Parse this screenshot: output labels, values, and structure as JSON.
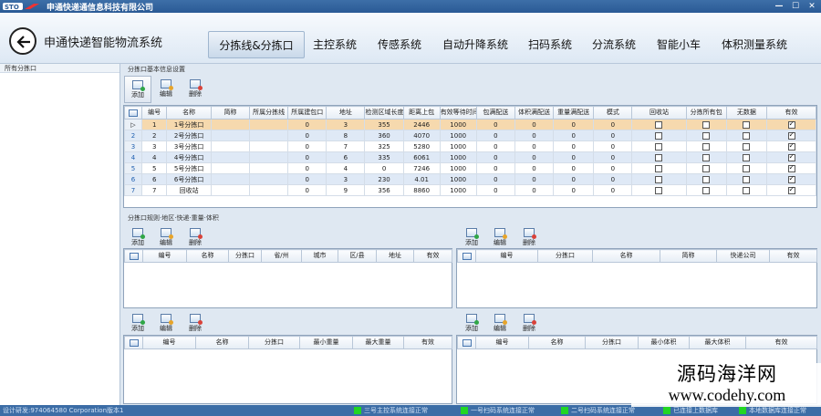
{
  "window": {
    "title": "申通快递通信息科技有限公司",
    "controls": [
      "—",
      "☐",
      "✕"
    ]
  },
  "app": {
    "title": "申通快递智能物流系统"
  },
  "nav": [
    "分拣线&分拣口",
    "主控系统",
    "传感系统",
    "自动升降系统",
    "扫码系统",
    "分流系统",
    "智能小车",
    "体积测量系统"
  ],
  "sidebar": {
    "header": "所有分拣口"
  },
  "top_section": {
    "title": "分拣口基本信息设置",
    "toolbar": [
      "添加",
      "编辑",
      "删除"
    ],
    "columns": [
      "编号",
      "名称",
      "简称",
      "所属分拣线",
      "所属建包口",
      "地址",
      "检测区域长度",
      "距离上包",
      "有效等待时间",
      "包满配送",
      "体积满配送",
      "重量满配送",
      "模式",
      "回收站",
      "分拣所有包",
      "无数据",
      "有效"
    ],
    "rows": [
      {
        "rownum": "1",
        "cells": [
          "1",
          "1号分拣口",
          "",
          "",
          "0",
          "3",
          "355",
          "2446",
          "1000",
          "0",
          "0",
          "0",
          "0"
        ],
        "flags": [
          false,
          false,
          false,
          true
        ]
      },
      {
        "rownum": "2",
        "cells": [
          "2",
          "2号分拣口",
          "",
          "",
          "0",
          "8",
          "360",
          "4070",
          "1000",
          "0",
          "0",
          "0",
          "0"
        ],
        "flags": [
          false,
          false,
          false,
          true
        ]
      },
      {
        "rownum": "3",
        "cells": [
          "3",
          "3号分拣口",
          "",
          "",
          "0",
          "7",
          "325",
          "5280",
          "1000",
          "0",
          "0",
          "0",
          "0"
        ],
        "flags": [
          false,
          false,
          false,
          true
        ]
      },
      {
        "rownum": "4",
        "cells": [
          "4",
          "4号分拣口",
          "",
          "",
          "0",
          "6",
          "335",
          "6061",
          "1000",
          "0",
          "0",
          "0",
          "0"
        ],
        "flags": [
          false,
          false,
          false,
          true
        ]
      },
      {
        "rownum": "5",
        "cells": [
          "5",
          "5号分拣口",
          "",
          "",
          "0",
          "4",
          "0",
          "7246",
          "1000",
          "0",
          "0",
          "0",
          "0"
        ],
        "flags": [
          false,
          false,
          false,
          true
        ]
      },
      {
        "rownum": "6",
        "cells": [
          "6",
          "6号分拣口",
          "",
          "",
          "0",
          "3",
          "230",
          "4.01",
          "1000",
          "0",
          "0",
          "0",
          "0"
        ],
        "flags": [
          false,
          false,
          false,
          true
        ]
      },
      {
        "rownum": "7",
        "cells": [
          "7",
          "回收站",
          "",
          "",
          "0",
          "9",
          "356",
          "8860",
          "1000",
          "0",
          "0",
          "0",
          "0"
        ],
        "flags": [
          false,
          false,
          false,
          true
        ]
      }
    ]
  },
  "rules_section": {
    "title": "分拣口规则·地区·快递·重量·体积"
  },
  "panel_a": {
    "toolbar": [
      "添加",
      "编辑",
      "删除"
    ],
    "columns": [
      "编号",
      "名称",
      "分拣口",
      "省/州",
      "城市",
      "区/县",
      "地址",
      "有效"
    ]
  },
  "panel_b": {
    "toolbar": [
      "添加",
      "编辑",
      "删除"
    ],
    "columns": [
      "编号",
      "分拣口",
      "名称",
      "简称",
      "快递公司",
      "有效"
    ]
  },
  "panel_c": {
    "toolbar": [
      "添加",
      "编辑",
      "删除"
    ],
    "columns": [
      "编号",
      "名称",
      "分拣口",
      "最小重量",
      "最大重量",
      "有效"
    ]
  },
  "panel_d": {
    "toolbar": [
      "添加",
      "编辑",
      "删除"
    ],
    "columns": [
      "编号",
      "名称",
      "分拣口",
      "最小体积",
      "最大体积",
      "有效"
    ]
  },
  "status": {
    "design": "设计研发:974064580 Corporation版本1",
    "indicators": [
      "三号主控系统连接正常",
      "一号扫码系统连接正常",
      "二号扫码系统连接正常",
      "已连接上数据库",
      "本地数据库连接正常"
    ],
    "led_color": "#22d622"
  },
  "watermark": {
    "line1": "源码海洋网",
    "line2": "www.codehy.com"
  }
}
